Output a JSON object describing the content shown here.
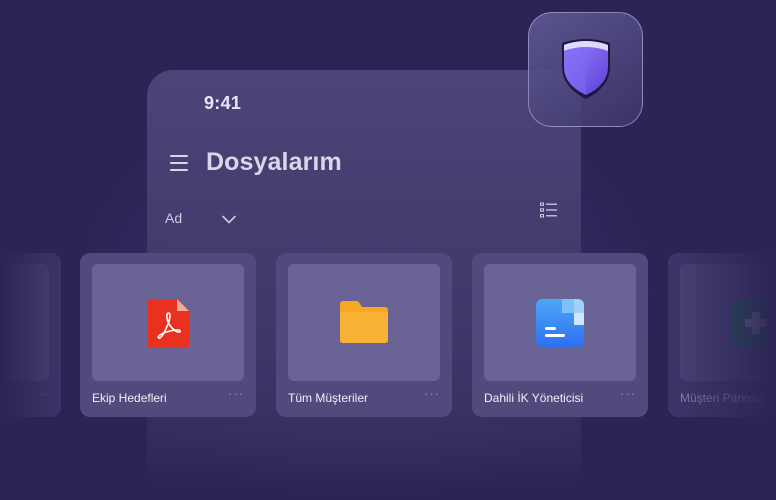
{
  "status_bar": {
    "time": "9:41"
  },
  "header": {
    "title": "Dosyalarım"
  },
  "sort": {
    "label": "Ad"
  },
  "icons": {
    "menu": "hamburger-menu-icon",
    "sort_chevron": "chevron-down-icon",
    "view": "list-view-icon",
    "app": "shield-icon"
  },
  "files": [
    {
      "name": "Ekip Hedefleri",
      "icon": "pdf-file-icon",
      "more": "···"
    },
    {
      "name": "Tüm Müşteriler",
      "icon": "folder-icon",
      "more": "···"
    },
    {
      "name": "Dahili İK Yöneticisi",
      "icon": "app-document-icon",
      "more": "···"
    },
    {
      "name": "Müşteri Panosu",
      "icon": "spreadsheet-icon",
      "more": "···"
    }
  ],
  "partial_left_card": {
    "more": "···"
  },
  "colors": {
    "background": "#2b2455",
    "panel": "#4b4578",
    "card": "#514b7d",
    "thumb": "#6a6496",
    "shield": "#7a5cf0",
    "pdf": "#e8321f",
    "folder": "#f7a823",
    "app_doc": "#3b82f6",
    "sheet": "#1f9d55"
  }
}
